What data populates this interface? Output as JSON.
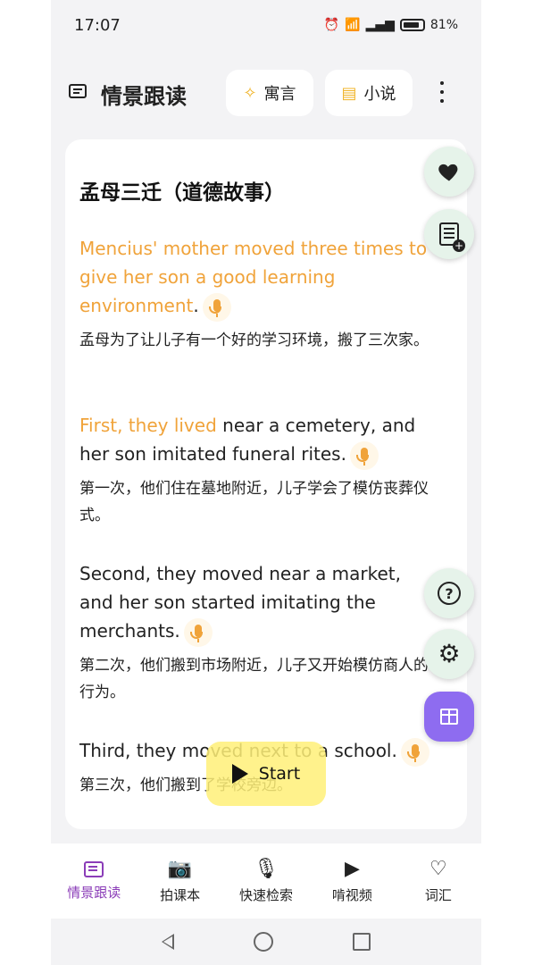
{
  "status": {
    "time": "17:07",
    "battery": "81%"
  },
  "header": {
    "title": "情景跟读",
    "chip1": "寓言",
    "chip2": "小说"
  },
  "story": {
    "title": "孟母三迁（道德故事）",
    "p1": {
      "en_hl": "Mencius' mother moved three times to give her son a good learning environment",
      "en_rest": ".",
      "zh": "孟母为了让儿子有一个好的学习环境，搬了三次家。"
    },
    "p2": {
      "en_hl": "First, they lived",
      "en_rest": " near a cemetery, and her son imitated funeral rites.",
      "zh": "第一次，他们住在墓地附近，儿子学会了模仿丧葬仪式。"
    },
    "p3": {
      "en_hl": "",
      "en_rest": "Second, they moved near a market, and her son started imitating the merchants.",
      "zh": "第二次，他们搬到市场附近，儿子又开始模仿商人的行为。"
    },
    "p4": {
      "en_hl": "",
      "en_rest": "Third, they moved next to a school.",
      "zh": "第三次，他们搬到了学校旁边。"
    }
  },
  "start_label": "Start",
  "nav": [
    {
      "label": "情景跟读"
    },
    {
      "label": "拍课本"
    },
    {
      "label": "快速检索"
    },
    {
      "label": "啃视频"
    },
    {
      "label": "词汇"
    }
  ],
  "colors": {
    "accent": "#f0a33a",
    "nav_active": "#8b3db8",
    "gift": "#8e6cf0"
  }
}
